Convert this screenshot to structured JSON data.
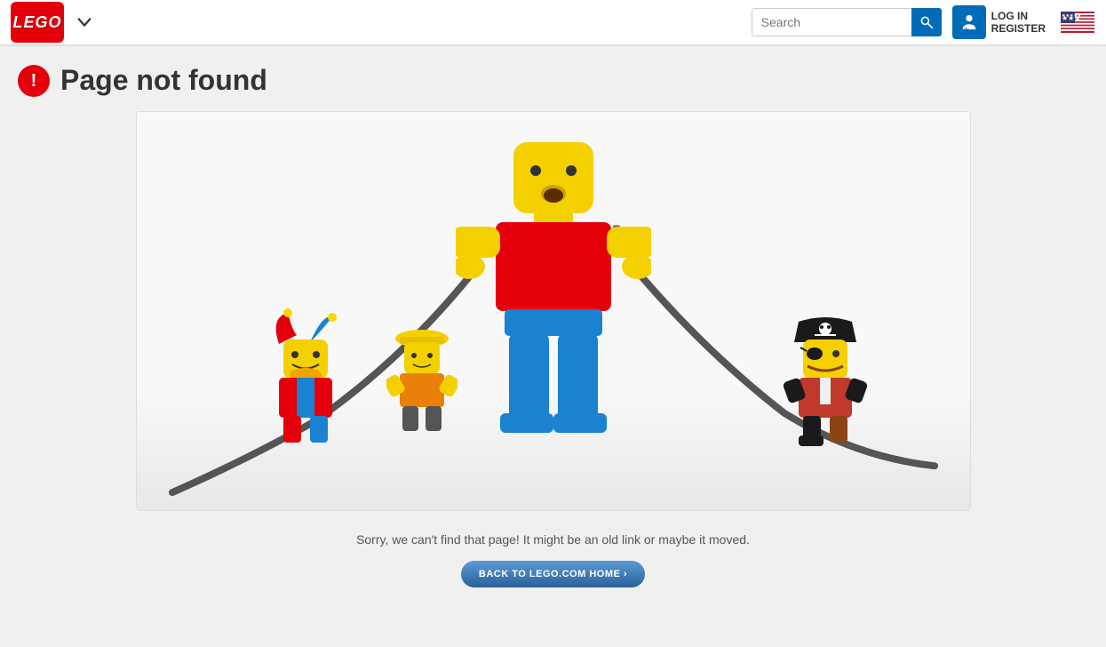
{
  "header": {
    "logo_text": "LEGO",
    "nav_dropdown_label": "navigation dropdown",
    "search_placeholder": "Search",
    "search_button_label": "Search",
    "lego_id_label": "LEGO\nID",
    "login_label": "LOG IN",
    "register_label": "REGISTER",
    "flag_label": "US Flag"
  },
  "page": {
    "error_icon": "warning",
    "title": "Page not found",
    "sorry_text": "Sorry, we can't find that page! It might be an old link or maybe it moved.",
    "back_button_label": "BACK TO LEGO.COM HOME"
  }
}
